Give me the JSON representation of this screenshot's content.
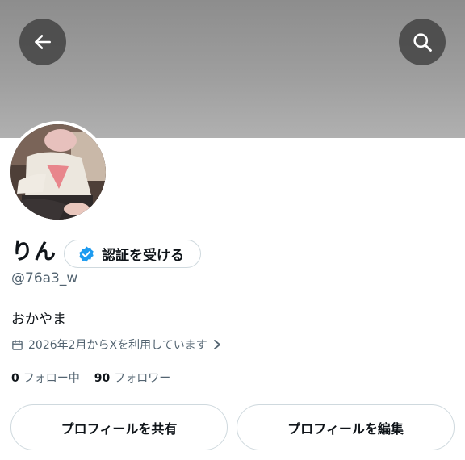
{
  "header": {
    "back_icon": "arrow-left-icon",
    "search_icon": "search-icon"
  },
  "profile": {
    "display_name": "りん",
    "verify_button_label": "認証を受ける",
    "verify_icon": "verified-badge-icon",
    "handle": "@76a3_w",
    "bio": "おかやま",
    "joined_icon": "calendar-icon",
    "joined_text": "2026年2月からXを利用しています",
    "joined_chevron": "chevron-right-icon"
  },
  "stats": {
    "following_count": "0",
    "following_label": "フォロー中",
    "followers_count": "90",
    "followers_label": "フォロワー"
  },
  "actions": {
    "share_label": "プロフィールを共有",
    "edit_label": "プロフィールを編集"
  },
  "colors": {
    "verified_blue": "#1d9bf0",
    "secondary_text": "#536471",
    "border": "#cfd9de"
  }
}
